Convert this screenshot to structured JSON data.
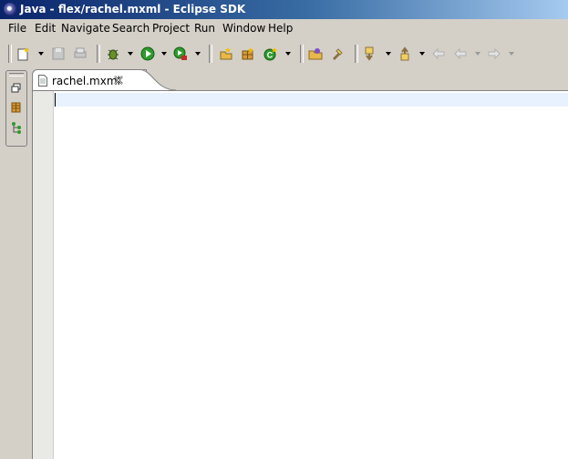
{
  "window": {
    "title": "Java - flex/rachel.mxml - Eclipse SDK"
  },
  "menu": [
    "File",
    "Edit",
    "Navigate",
    "Search",
    "Project",
    "Run",
    "Window",
    "Help"
  ],
  "editor": {
    "tab_label": "rachel.mxml"
  },
  "colors": {
    "titlebar_start": "#0a246a",
    "titlebar_end": "#a6caf0",
    "chrome": "#d4d0c8",
    "current_line": "#e8f2fe"
  }
}
